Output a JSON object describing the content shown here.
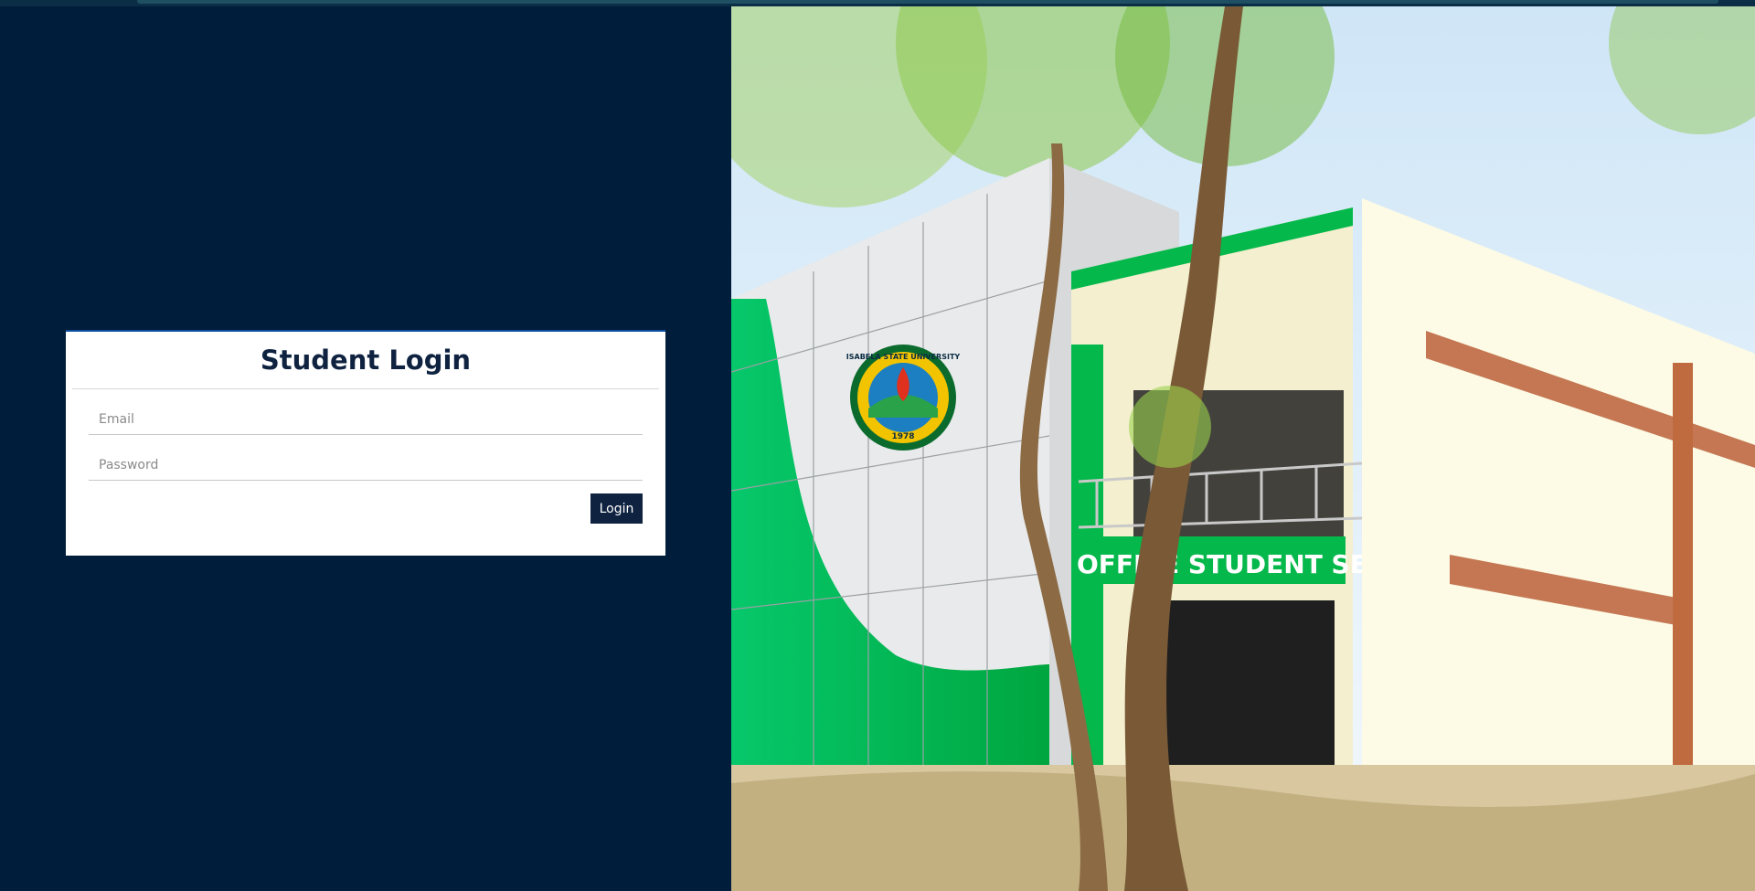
{
  "login": {
    "title": "Student Login",
    "email_placeholder": "Email",
    "password_placeholder": "Password",
    "submit_label": "Login"
  },
  "photo": {
    "seal_text": "ISABELA STATE UNIVERSITY",
    "seal_year": "1978",
    "sign_text": "OFFICE STUDENT SERVIC"
  },
  "colors": {
    "background": "#001d3b",
    "card": "#ffffff",
    "accent": "#0f2341",
    "building_green": "#00b54a"
  }
}
